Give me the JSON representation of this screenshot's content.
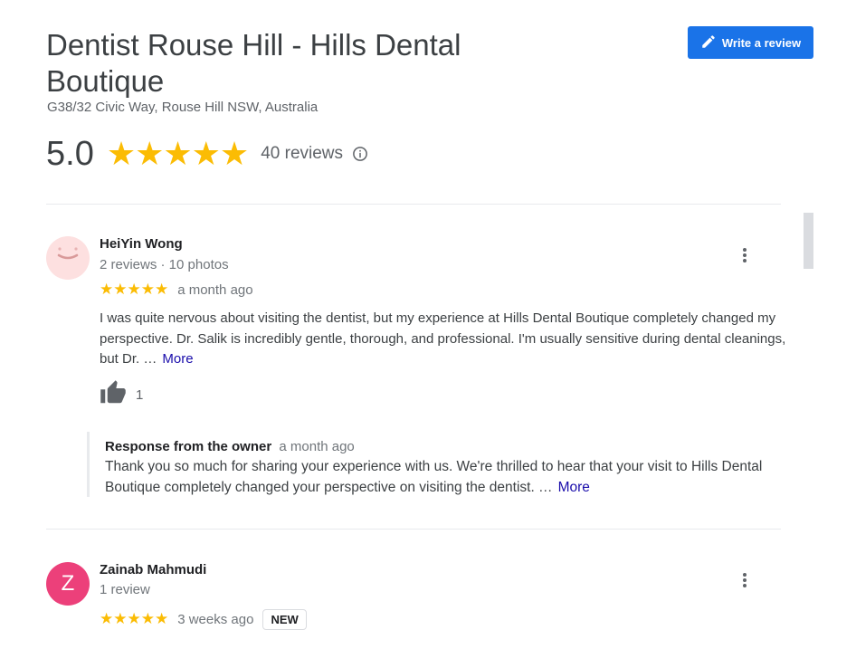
{
  "business": {
    "name": "Dentist Rouse Hill - Hills Dental Boutique",
    "address": "G38/32 Civic Way, Rouse Hill NSW, Australia",
    "rating": "5.0",
    "stars": "★★★★★",
    "review_count": "40 reviews"
  },
  "write_review_label": "Write a review",
  "reviews": [
    {
      "author": "HeiYin Wong",
      "meta": "2 reviews · 10 photos",
      "stars": "★★★★★",
      "time": "a month ago",
      "text": "I was quite nervous about visiting the dentist, but my experience at Hills Dental Boutique completely changed my perspective. Dr. Salik is incredibly gentle, thorough, and professional. I'm usually sensitive during dental cleanings, but Dr. …",
      "more_label": "More",
      "likes": "1",
      "owner_response": {
        "title": "Response from the owner",
        "time": "a month ago",
        "text": "Thank you so much for sharing your experience with us. We're thrilled to hear that your visit to Hills Dental Boutique completely changed your perspective on visiting the dentist. …",
        "more_label": "More"
      }
    },
    {
      "author": "Zainab Mahmudi",
      "avatar_letter": "Z",
      "meta": "1 review",
      "stars": "★★★★★",
      "time": "3 weeks ago",
      "badge": "NEW"
    }
  ],
  "colors": {
    "accent": "#1a73e8",
    "star": "#fbbc04",
    "link": "#1a0dab",
    "avatar_z": "#ec407a"
  },
  "icons": [
    "pencil-icon",
    "info-icon",
    "more-vert-icon",
    "thumb-up-icon"
  ]
}
